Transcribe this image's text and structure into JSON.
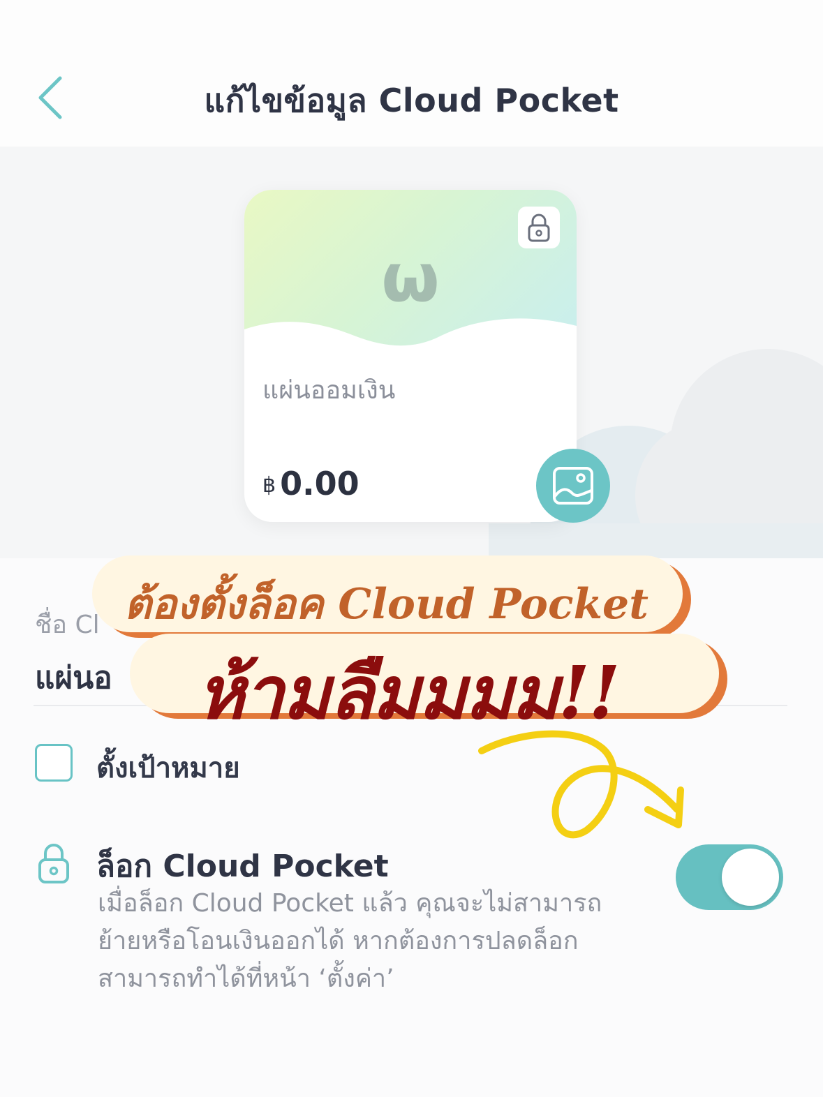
{
  "header": {
    "title": "แก้ไขข้อมูล Cloud Pocket"
  },
  "card": {
    "glyph": "ω",
    "name": "แผ่นออมเงิน",
    "currency": "฿",
    "amount": "0.00"
  },
  "form": {
    "name_label": "ชื่อ Cl",
    "name_value": "แผ่นอ"
  },
  "goal": {
    "label": "ตั้งเป้าหมาย",
    "checked": false
  },
  "lock": {
    "title": "ล็อก Cloud Pocket",
    "description_lines": [
      "เมื่อล็อก Cloud Pocket แล้ว คุณจะไม่สามารถ",
      "ย้ายหรือโอนเงินออกได้ หากต้องการปลดล็อก",
      "สามารถทำได้ที่หน้า ‘ตั้งค่า’"
    ],
    "enabled": true
  },
  "overlay": {
    "line1": "ต้องตั้งล็อค Cloud Pocket",
    "line2": "ห้ามลืมมมม!!"
  },
  "colors": {
    "accent": "#66c0c1",
    "banner_bg": "#fff6e2",
    "banner_shadow": "#e2793a",
    "banner_text1": "#c1622a",
    "banner_text2": "#8b0d0d",
    "arrow": "#f4cf13"
  },
  "icons": {
    "back": "chevron-left-icon",
    "card_lock": "padlock-icon",
    "change_image": "image-icon",
    "lock_row": "padlock-icon"
  }
}
